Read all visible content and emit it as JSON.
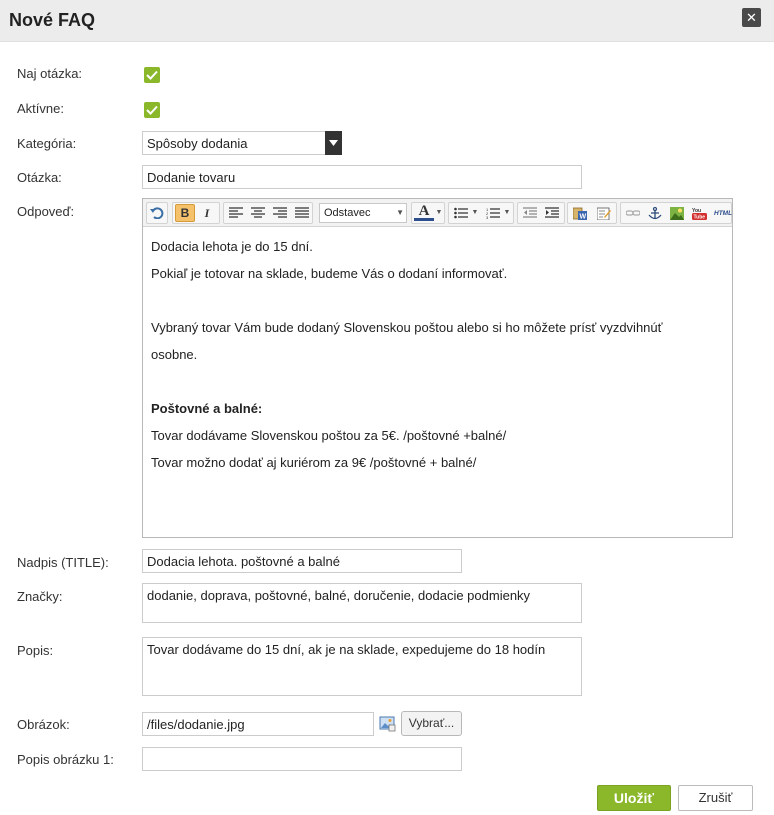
{
  "dialog": {
    "title": "Nové FAQ",
    "close_icon": "close-icon",
    "close_label": "✕"
  },
  "form": {
    "top_question_label": "Naj otázka:",
    "top_question_checked": true,
    "active_label": "Aktívne:",
    "active_checked": true,
    "category_label": "Kategória:",
    "category_value": "Spôsoby dodania",
    "question_label": "Otázka:",
    "question_value": "Dodanie tovaru",
    "answer_label": "Odpoveď:",
    "title_label": "Nadpis (TITLE):",
    "title_value": "Dodacia lehota. poštovné a balné",
    "tags_label": "Značky:",
    "tags_value": "dodanie, doprava, poštovné, balné, doručenie, dodacie podmienky",
    "description_label": "Popis:",
    "description_value": "Tovar dodávame do 15 dní, ak je na sklade, expedujeme do 18 hodín",
    "image_label": "Obrázok:",
    "image_value": "/files/dodanie.jpg",
    "image_pick_label": "Vybrať...",
    "image_caption_label": "Popis obrázku 1:",
    "image_caption_value": ""
  },
  "editor": {
    "toolbar": {
      "undo_icon": "undo-icon",
      "bold_label": "B",
      "italic_label": "I",
      "align_icons": [
        "align-left-icon",
        "align-center-icon",
        "align-right-icon",
        "align-justify-icon"
      ],
      "format_value": "Odstavec",
      "text_color_label": "A",
      "list_icons": [
        "bullet-list-icon",
        "numbered-list-icon"
      ],
      "indent_icons": [
        "outdent-icon",
        "indent-icon"
      ],
      "paste_icons": [
        "paste-word-icon",
        "edit-icon"
      ],
      "insert_icons": [
        "link-icon",
        "anchor-icon",
        "image-icon",
        "youtube-icon",
        "html-icon"
      ],
      "youtube_label": "You Tube",
      "html_label": "HTML"
    },
    "content": {
      "line1": "Dodacia lehota je do 15 dní.",
      "line2": "Pokiaľ je totovar na sklade, budeme Vás o dodaní informovať.",
      "line3": "Vybraný tovar Vám bude dodaný Slovenskou poštou alebo si ho môžete prísť vyzdvihnúť",
      "line4": "osobne.",
      "heading": "Poštovné a balné:",
      "line5": "Tovar dodávame Slovenskou poštou za 5€. /poštovné +balné/",
      "line6": "Tovar možno dodať aj kuriérom za 9€ /poštovné + balné/"
    }
  },
  "actions": {
    "save_label": "Uložiť",
    "cancel_label": "Zrušiť"
  },
  "colors": {
    "accent": "#8bb82b",
    "titlebar": "#ececec"
  }
}
